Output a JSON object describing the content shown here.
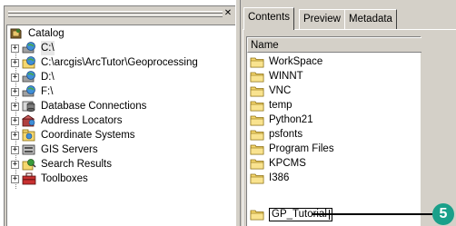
{
  "catalog_tree": {
    "root_label": "Catalog",
    "root_icon": "catalog-root-icon",
    "items": [
      {
        "label": "C:\\",
        "icon": "drive-connection-icon",
        "selected": true
      },
      {
        "label": "C:\\arcgis\\ArcTutor\\Geoprocessing",
        "icon": "folder-connection-icon"
      },
      {
        "label": "D:\\",
        "icon": "drive-connection-icon"
      },
      {
        "label": "F:\\",
        "icon": "drive-connection-icon"
      },
      {
        "label": "Database Connections",
        "icon": "database-connections-icon"
      },
      {
        "label": "Address Locators",
        "icon": "address-locators-icon"
      },
      {
        "label": "Coordinate Systems",
        "icon": "coordinate-systems-icon"
      },
      {
        "label": "GIS Servers",
        "icon": "gis-servers-icon"
      },
      {
        "label": "Search Results",
        "icon": "search-results-icon"
      },
      {
        "label": "Toolboxes",
        "icon": "toolboxes-icon"
      }
    ],
    "expand_glyph": "+",
    "close_glyph": "✕"
  },
  "tabs": [
    {
      "label": "Contents",
      "active": true
    },
    {
      "label": "Preview",
      "active": false
    },
    {
      "label": "Metadata",
      "active": false
    }
  ],
  "contents": {
    "column_header": "Name",
    "items": [
      {
        "label": "WorkSpace"
      },
      {
        "label": "WINNT"
      },
      {
        "label": "VNC"
      },
      {
        "label": "temp"
      },
      {
        "label": "Python21"
      },
      {
        "label": "psfonts"
      },
      {
        "label": "Program Files"
      },
      {
        "label": "KPCMS"
      },
      {
        "label": "I386"
      }
    ],
    "rename_value": "GP_Tutorial"
  },
  "callout": {
    "number": "5"
  },
  "colors": {
    "folder_yellow": "#f5d76e",
    "callout_teal": "#1aa08a",
    "chrome_gray": "#d4d0c8"
  }
}
